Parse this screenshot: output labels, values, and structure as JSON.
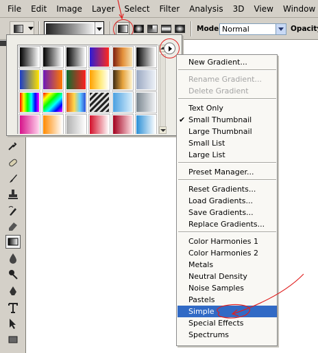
{
  "menubar": {
    "items": [
      "File",
      "Edit",
      "Image",
      "Layer",
      "Select",
      "Filter",
      "Analysis",
      "3D",
      "View",
      "Window"
    ]
  },
  "options_bar": {
    "mode_label": "Mode:",
    "mode_value": "Normal",
    "opacity_label": "Opacity:"
  },
  "gradient_types": [
    "linear-gradient-icon",
    "radial-gradient-icon",
    "angle-gradient-icon",
    "reflected-gradient-icon",
    "diamond-gradient-icon"
  ],
  "gradient_picker": {
    "swatches": [
      "linear-gradient(to right, #000, #fff)",
      "linear-gradient(to right, #000, #fff)",
      "linear-gradient(to right, #000, #fff)",
      "linear-gradient(to right, #2b1bd6, #ff2a1e)",
      "linear-gradient(to right, #7c1f10, #e4903a 50%, #f5e2b3)",
      "linear-gradient(to right, #000, #fff)",
      "linear-gradient(to right, #1a3bc6, #ffe400)",
      "linear-gradient(to right, #6b18b8, #ff7a00)",
      "linear-gradient(to right, #0a6e2e, #ff2020)",
      "linear-gradient(to right, #ffa000, #ffee88 60%, #fff)",
      "linear-gradient(to right, #3b2a12, #e6a23c 50%, #fff5d0)",
      "linear-gradient(to right, #9aa8c2, #eef2f8)",
      "linear-gradient(to right, #ff0000, #ffff00, #00ff00, #00ffff, #0000ff, #ff00ff)",
      "linear-gradient(135deg, #ff0000, #ffff00, #00ff00, #00ffff, #0000ff, #ff00ff)",
      "linear-gradient(to right, #e05a1a, #ffd84d 40%, #66d1ff 70%, #2a4cd6)",
      "repeating-linear-gradient(135deg, #222 0 3px, #ddd 3px 6px)",
      "linear-gradient(to right, #4aa0e0, #d8eefc)",
      "linear-gradient(to right, #7a8690, #f2f4f6)",
      "linear-gradient(to right, #d6138a, #ffd1ec)",
      "linear-gradient(to right, #ff8a00, #fff)",
      "linear-gradient(to right, #b0b0b0, #fff)",
      "linear-gradient(to right, #d3102a, #ffffff)",
      "linear-gradient(to right, #a2001d, #ffe1e6)",
      "linear-gradient(to right, #2a8fd6, #ffffff)"
    ]
  },
  "flyout_menu": {
    "items": [
      {
        "label": "New Gradient...",
        "type": "item"
      },
      {
        "type": "separator"
      },
      {
        "label": "Rename Gradient...",
        "type": "item",
        "disabled": true
      },
      {
        "label": "Delete Gradient",
        "type": "item",
        "disabled": true
      },
      {
        "type": "separator"
      },
      {
        "label": "Text Only",
        "type": "item"
      },
      {
        "label": "Small Thumbnail",
        "type": "item",
        "checked": true
      },
      {
        "label": "Large Thumbnail",
        "type": "item"
      },
      {
        "label": "Small List",
        "type": "item"
      },
      {
        "label": "Large List",
        "type": "item"
      },
      {
        "type": "separator"
      },
      {
        "label": "Preset Manager...",
        "type": "item"
      },
      {
        "type": "separator"
      },
      {
        "label": "Reset Gradients...",
        "type": "item"
      },
      {
        "label": "Load Gradients...",
        "type": "item"
      },
      {
        "label": "Save Gradients...",
        "type": "item"
      },
      {
        "label": "Replace Gradients...",
        "type": "item"
      },
      {
        "type": "separator"
      },
      {
        "label": "Color Harmonies 1",
        "type": "item"
      },
      {
        "label": "Color Harmonies 2",
        "type": "item"
      },
      {
        "label": "Metals",
        "type": "item"
      },
      {
        "label": "Neutral Density",
        "type": "item"
      },
      {
        "label": "Noise Samples",
        "type": "item"
      },
      {
        "label": "Pastels",
        "type": "item"
      },
      {
        "label": "Simple",
        "type": "item",
        "selected": true
      },
      {
        "label": "Special Effects",
        "type": "item"
      },
      {
        "label": "Spectrums",
        "type": "item"
      }
    ]
  },
  "annotation_color": "#e02020",
  "selection_color": "#316ac5"
}
